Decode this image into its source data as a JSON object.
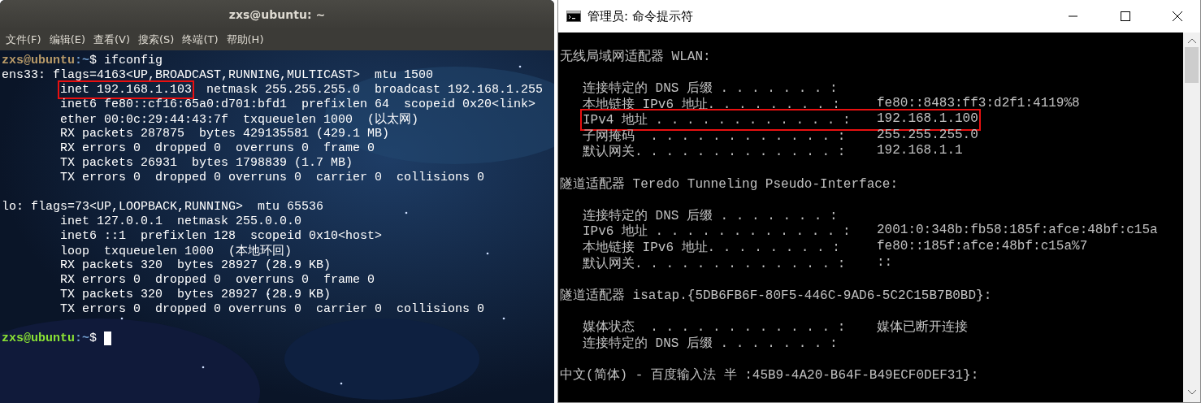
{
  "terminal": {
    "title": "zxs@ubuntu: ~",
    "menu": [
      "文件(F)",
      "编辑(E)",
      "查看(V)",
      "搜索(S)",
      "终端(T)",
      "帮助(H)"
    ],
    "lines": [
      {
        "kind": "prompt",
        "user": "zxs@ubuntu",
        "path": ":~",
        "symbol": "$",
        "command": "ifconfig",
        "color": "#b89a68"
      },
      {
        "kind": "header",
        "parts": [
          {
            "text": "ens33: flags=4163<UP,BROADCAST,RUNNING,MULTICAST>  mtu 1500",
            "boxed": false
          }
        ]
      },
      {
        "kind": "detail",
        "parts": [
          {
            "text": "inet 192.168.1.103",
            "boxed": true
          },
          {
            "text": "  netmask 255.255.255.0  broadcast 192.168.1.255",
            "boxed": false
          }
        ]
      },
      {
        "kind": "detail",
        "parts": [
          {
            "text": "inet6 fe80::cf16:65a0:d701:bfd1  prefixlen 64  scopeid 0x20<link>",
            "boxed": false
          }
        ]
      },
      {
        "kind": "detail",
        "parts": [
          {
            "text": "ether 00:0c:29:44:43:7f  txqueuelen 1000  (以太网)",
            "boxed": false
          }
        ]
      },
      {
        "kind": "detail",
        "parts": [
          {
            "text": "RX packets 287875  bytes 429135581 (429.1 MB)",
            "boxed": false
          }
        ]
      },
      {
        "kind": "detail",
        "parts": [
          {
            "text": "RX errors 0  dropped 0  overruns 0  frame 0",
            "boxed": false
          }
        ]
      },
      {
        "kind": "detail",
        "parts": [
          {
            "text": "TX packets 26931  bytes 1798839 (1.7 MB)",
            "boxed": false
          }
        ]
      },
      {
        "kind": "detail",
        "parts": [
          {
            "text": "TX errors 0  dropped 0 overruns 0  carrier 0  collisions 0",
            "boxed": false
          }
        ]
      },
      {
        "kind": "blank"
      },
      {
        "kind": "header",
        "parts": [
          {
            "text": "lo: flags=73<UP,LOOPBACK,RUNNING>  mtu 65536",
            "boxed": false
          }
        ]
      },
      {
        "kind": "detail",
        "parts": [
          {
            "text": "inet 127.0.0.1  netmask 255.0.0.0",
            "boxed": false
          }
        ]
      },
      {
        "kind": "detail",
        "parts": [
          {
            "text": "inet6 ::1  prefixlen 128  scopeid 0x10<host>",
            "boxed": false
          }
        ]
      },
      {
        "kind": "detail",
        "parts": [
          {
            "text": "loop  txqueuelen 1000  (本地环回)",
            "boxed": false
          }
        ]
      },
      {
        "kind": "detail",
        "parts": [
          {
            "text": "RX packets 320  bytes 28927 (28.9 KB)",
            "boxed": false
          }
        ]
      },
      {
        "kind": "detail",
        "parts": [
          {
            "text": "RX errors 0  dropped 0  overruns 0  frame 0",
            "boxed": false
          }
        ]
      },
      {
        "kind": "detail",
        "parts": [
          {
            "text": "TX packets 320  bytes 28927 (28.9 KB)",
            "boxed": false
          }
        ]
      },
      {
        "kind": "detail",
        "parts": [
          {
            "text": "TX errors 0  dropped 0 overruns 0  carrier 0  collisions 0",
            "boxed": false
          }
        ]
      },
      {
        "kind": "blank"
      },
      {
        "kind": "prompt",
        "user": "zxs@ubuntu",
        "path": ":~",
        "symbol": "$",
        "color": "#8ae234",
        "cursor": true
      }
    ]
  },
  "cmd": {
    "title": "管理员: 命令提示符",
    "lines": [
      {
        "kind": "blank"
      },
      {
        "kind": "section",
        "text": "无线局域网适配器 WLAN:"
      },
      {
        "kind": "blank"
      },
      {
        "kind": "field",
        "label": "连接特定的 DNS 后缀 . . . . . . . :",
        "boxed": false
      },
      {
        "kind": "field",
        "label": "本地链接 IPv6 地址. . . . . . . . :",
        "value": "fe80::8483:ff3:d2f1:4119%8",
        "boxed": false
      },
      {
        "kind": "field",
        "label": "IPv4 地址 . . . . . . . . . . . . :",
        "value": "192.168.1.100",
        "boxed": true
      },
      {
        "kind": "field",
        "label": "子网掩码  . . . . . . . . . . . . :",
        "value": "255.255.255.0",
        "boxed": false
      },
      {
        "kind": "field",
        "label": "默认网关. . . . . . . . . . . . . :",
        "value": "192.168.1.1",
        "boxed": false
      },
      {
        "kind": "blank"
      },
      {
        "kind": "section",
        "text": "隧道适配器 Teredo Tunneling Pseudo-Interface:"
      },
      {
        "kind": "blank"
      },
      {
        "kind": "field",
        "label": "连接特定的 DNS 后缀 . . . . . . . :",
        "boxed": false
      },
      {
        "kind": "field",
        "label": "IPv6 地址 . . . . . . . . . . . . :",
        "value": "2001:0:348b:fb58:185f:afce:48bf:c15a",
        "boxed": false
      },
      {
        "kind": "field",
        "label": "本地链接 IPv6 地址. . . . . . . . :",
        "value": "fe80::185f:afce:48bf:c15a%7",
        "boxed": false
      },
      {
        "kind": "field",
        "label": "默认网关. . . . . . . . . . . . . :",
        "value": "::",
        "boxed": false
      },
      {
        "kind": "blank"
      },
      {
        "kind": "section",
        "text": "隧道适配器 isatap.{5DB6FB6F-80F5-446C-9AD6-5C2C15B7B0BD}:"
      },
      {
        "kind": "blank"
      },
      {
        "kind": "field",
        "label": "媒体状态  . . . . . . . . . . . . :",
        "value": "媒体已断开连接",
        "boxed": false
      },
      {
        "kind": "field",
        "label": "连接特定的 DNS 后缀 . . . . . . . :",
        "boxed": false
      },
      {
        "kind": "blank"
      },
      {
        "kind": "section",
        "text": "中文(简体) - 百度输入法 半 :45B9-4A20-B64F-B49ECF0DEF31}:"
      }
    ]
  }
}
